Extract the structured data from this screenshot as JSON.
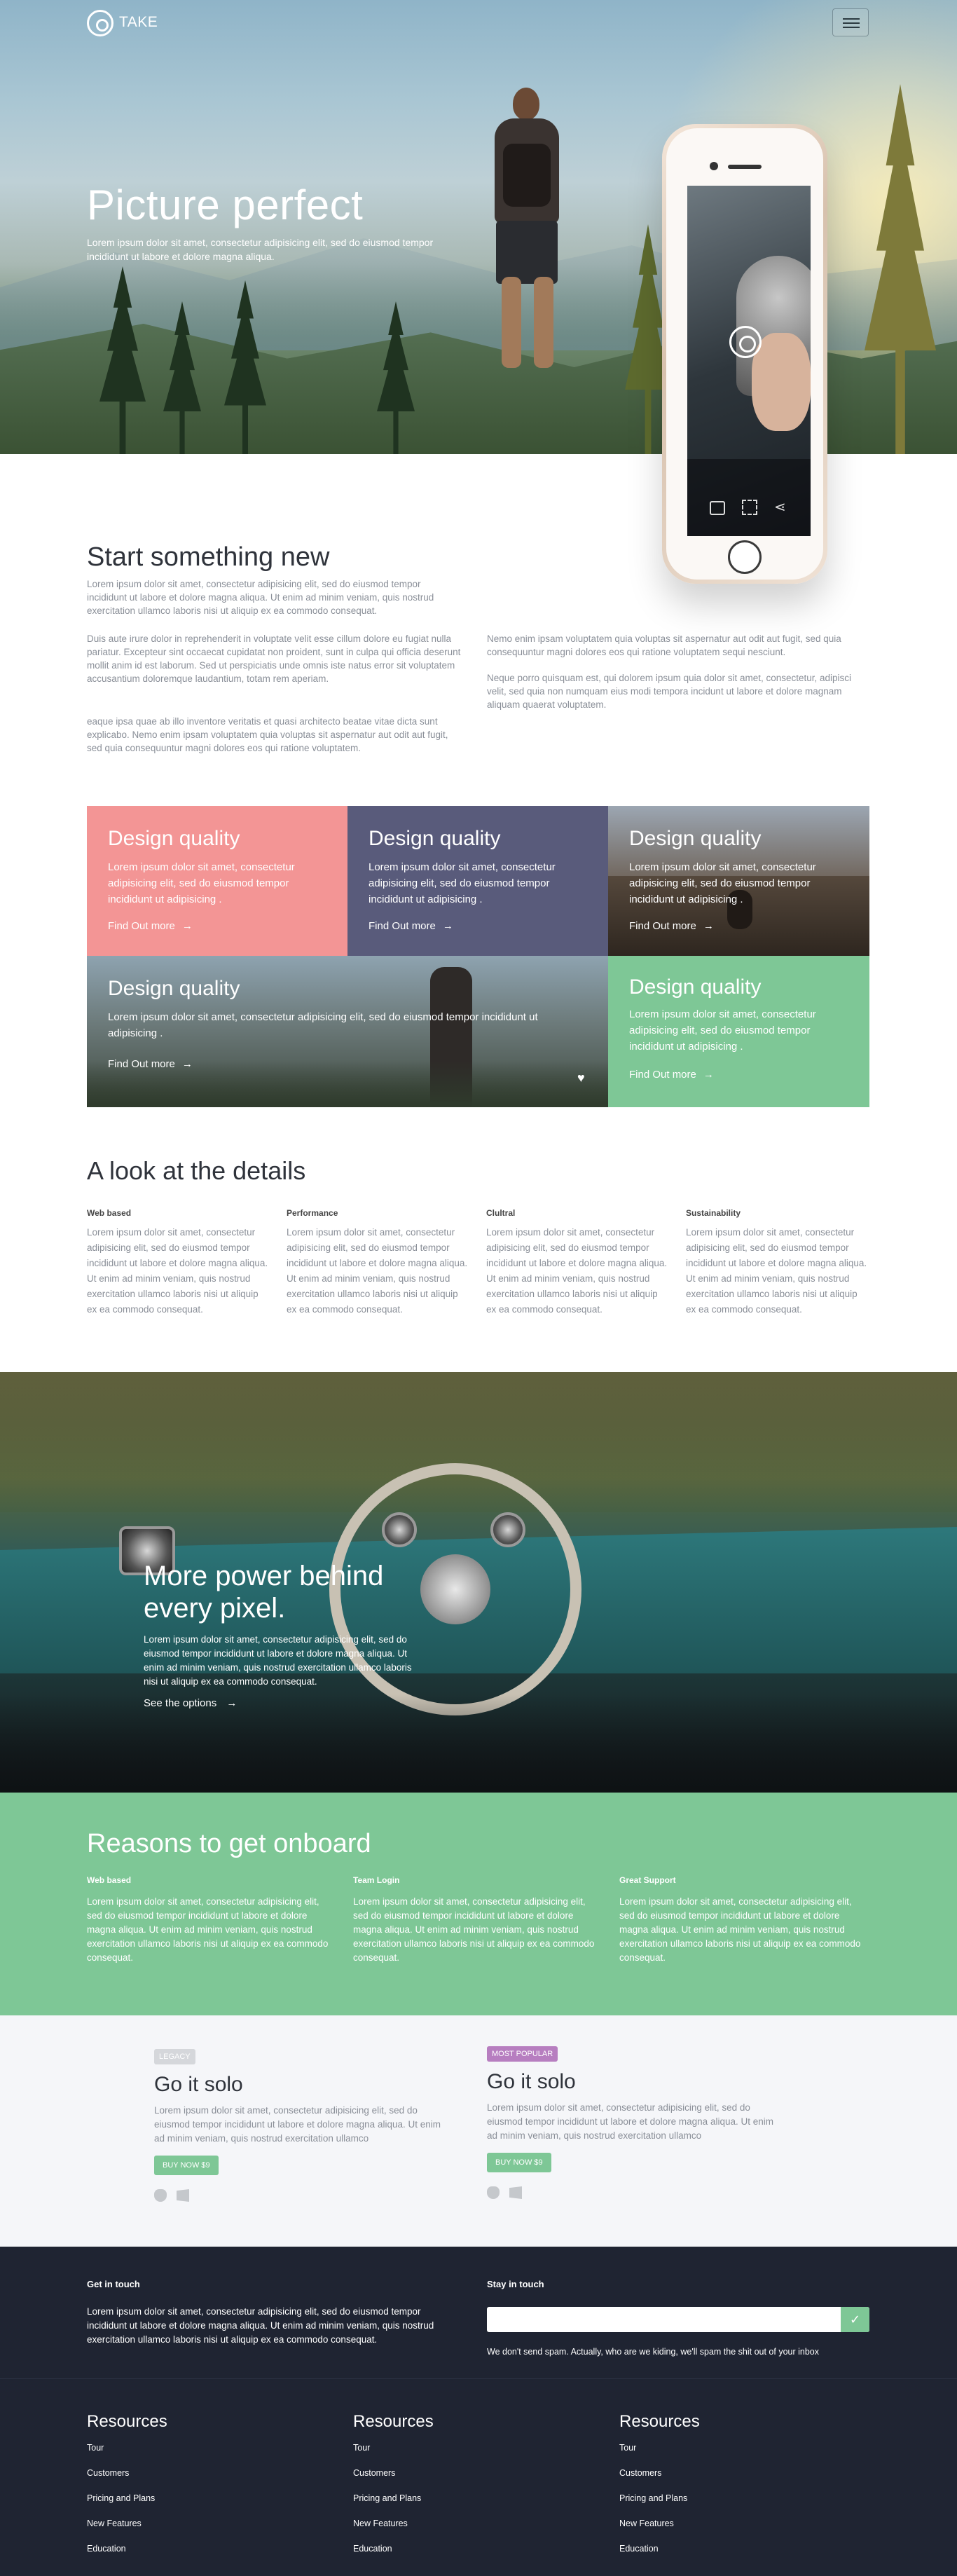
{
  "nav": {
    "logo": "TAKE"
  },
  "hero": {
    "title": "Picture perfect",
    "lead": "Lorem ipsum dolor sit amet, consectetur adipisicing elit, sed do eiusmod tempor incididunt ut labore et dolore magna aliqua."
  },
  "intro": {
    "title": "Start something new",
    "p1": "Lorem ipsum dolor sit amet, consectetur adipisicing elit, sed do eiusmod tempor incididunt ut labore et dolore magna aliqua. Ut enim ad minim veniam, quis nostrud exercitation ullamco laboris nisi ut aliquip ex ea commodo consequat.",
    "p2": "Duis aute irure dolor in reprehenderit in voluptate velit esse cillum dolore eu fugiat nulla pariatur. Excepteur sint occaecat cupidatat non proident, sunt in culpa qui officia deserunt mollit anim id est laborum. Sed ut perspiciatis unde omnis iste natus error sit voluptatem accusantium doloremque laudantium, totam rem aperiam.",
    "p3": "eaque ipsa quae ab illo inventore veritatis et quasi architecto beatae vitae dicta sunt explicabo. Nemo enim ipsam voluptatem quia voluptas sit aspernatur aut odit aut fugit, sed quia consequuntur magni dolores eos qui ratione voluptatem.",
    "r1": "Nemo enim ipsam voluptatem quia voluptas sit aspernatur aut odit aut fugit, sed quia consequuntur magni dolores eos qui ratione voluptatem sequi nesciunt.",
    "r2": "Neque porro quisquam est, qui dolorem ipsum quia dolor sit amet, consectetur, adipisci velit, sed quia non numquam eius modi tempora incidunt ut labore et dolore magnam aliquam quaerat voluptatem."
  },
  "tiles": {
    "t1": {
      "title": "Design quality",
      "text": "Lorem ipsum dolor sit amet, consectetur adipisicing elit, sed do eiusmod tempor incididunt ut adipisicing .",
      "link": "Find Out more",
      "color": "#f39595"
    },
    "t2": {
      "title": "Design quality",
      "text": "Lorem ipsum dolor sit amet, consectetur adipisicing elit, sed do eiusmod tempor incididunt ut adipisicing .",
      "link": "Find Out more",
      "color": "#595b7b"
    },
    "t3": {
      "title": "Design quality",
      "text": "Lorem ipsum dolor sit amet, consectetur adipisicing elit, sed do eiusmod tempor incididunt ut adipisicing .",
      "link": "Find Out more"
    },
    "t4": {
      "title": "Design quality",
      "text": "Lorem ipsum dolor sit amet, consectetur adipisicing elit, sed do eiusmod tempor incididunt ut adipisicing .",
      "link": "Find Out more"
    },
    "t5": {
      "title": "Design quality",
      "text": "Lorem ipsum dolor sit amet, consectetur adipisicing elit, sed do eiusmod tempor incididunt ut adipisicing .",
      "link": "Find Out more",
      "color": "#7ec796"
    }
  },
  "details": {
    "title": "A look at the details",
    "cols": [
      {
        "h": "Web based",
        "p": "Lorem ipsum dolor sit amet, consectetur adipisicing elit, sed do eiusmod tempor incididunt ut labore et dolore magna aliqua. Ut enim ad minim veniam, quis nostrud exercitation ullamco laboris nisi ut aliquip ex ea commodo consequat."
      },
      {
        "h": "Performance",
        "p": "Lorem ipsum dolor sit amet, consectetur adipisicing elit, sed do eiusmod tempor incididunt ut labore et dolore magna aliqua. Ut enim ad minim veniam, quis nostrud exercitation ullamco laboris nisi ut aliquip ex ea commodo consequat."
      },
      {
        "h": "Clultral",
        "p": "Lorem ipsum dolor sit amet, consectetur adipisicing elit, sed do eiusmod tempor incididunt ut labore et dolore magna aliqua. Ut enim ad minim veniam, quis nostrud exercitation ullamco laboris nisi ut aliquip ex ea commodo consequat."
      },
      {
        "h": "Sustainability",
        "p": "Lorem ipsum dolor sit amet, consectetur adipisicing elit, sed do eiusmod tempor incididunt ut labore et dolore magna aliqua. Ut enim ad minim veniam, quis nostrud exercitation ullamco laboris nisi ut aliquip ex ea commodo consequat."
      }
    ]
  },
  "feature": {
    "title": "More power behind every pixel.",
    "text": "Lorem ipsum dolor sit amet, consectetur adipisicing elit, sed do eiusmod tempor incididunt ut labore et dolore magna aliqua. Ut enim ad minim veniam, quis nostrud exercitation ullamco laboris nisi ut aliquip ex ea commodo consequat.",
    "link": "See the options"
  },
  "reasons": {
    "title": "Reasons to get onboard",
    "cols": [
      {
        "h": "Web based",
        "p": "Lorem ipsum dolor sit amet, consectetur adipisicing elit, sed do eiusmod tempor incididunt ut labore et dolore magna aliqua. Ut enim ad minim veniam, quis nostrud exercitation ullamco laboris nisi ut aliquip ex ea commodo consequat."
      },
      {
        "h": "Team Login",
        "p": "Lorem ipsum dolor sit amet, consectetur adipisicing elit, sed do eiusmod tempor incididunt ut labore et dolore magna aliqua. Ut enim ad minim veniam, quis nostrud exercitation ullamco laboris nisi ut aliquip ex ea commodo consequat."
      },
      {
        "h": "Great Support",
        "p": "Lorem ipsum dolor sit amet, consectetur adipisicing elit, sed do eiusmod tempor incididunt ut labore et dolore magna aliqua. Ut enim ad minim veniam, quis nostrud exercitation ullamco laboris nisi ut aliquip ex ea commodo consequat."
      }
    ]
  },
  "pricing": {
    "p1": {
      "badge": "LEGACY",
      "badge_color": "#d5d7db",
      "title": "Go it solo",
      "text": "Lorem ipsum dolor sit amet, consectetur adipisicing elit, sed do eiusmod tempor incididunt ut labore et dolore magna aliqua. Ut enim ad minim veniam, quis nostrud exercitation ullamco",
      "button": "BUY NOW $9"
    },
    "p2": {
      "badge": "MOST POPULAR",
      "badge_color": "#b77ec0",
      "title": "Go it solo",
      "text": "Lorem ipsum dolor sit amet, consectetur adipisicing elit, sed do eiusmod tempor incididunt ut labore et dolore magna aliqua. Ut enim ad minim veniam, quis nostrud exercitation ullamco",
      "button": "BUY NOW $9"
    }
  },
  "footer": {
    "get_in_touch": "Get in touch",
    "touch_text": "Lorem ipsum dolor sit amet, consectetur adipisicing elit, sed do eiusmod tempor incididunt ut labore et dolore magna aliqua. Ut enim ad minim veniam, quis nostrud exercitation ullamco laboris nisi ut aliquip ex ea commodo consequat.",
    "stay_in_touch": "Stay in touch",
    "email_value": "",
    "spam_note": "We don't send spam. Actually, who are we kiding, we'll spam the shit out of your inbox",
    "resources": [
      {
        "title": "Resources",
        "links": [
          "Tour",
          "Customers",
          "Pricing and Plans",
          "New Features",
          "Education"
        ]
      },
      {
        "title": "Resources",
        "links": [
          "Tour",
          "Customers",
          "Pricing and Plans",
          "New Features",
          "Education"
        ]
      },
      {
        "title": "Resources",
        "links": [
          "Tour",
          "Customers",
          "Pricing and Plans",
          "New Features",
          "Education"
        ]
      }
    ]
  },
  "icons": {
    "menu": "hamburger-icon",
    "arrow": "arrow-right-icon",
    "heart": "heart-icon",
    "check": "check-icon",
    "apple": "apple-icon",
    "windows": "windows-icon"
  },
  "colors": {
    "pink": "#f39595",
    "slate": "#595b7b",
    "green": "#7ec796",
    "dark": "#1f2432",
    "purple": "#b77ec0"
  }
}
